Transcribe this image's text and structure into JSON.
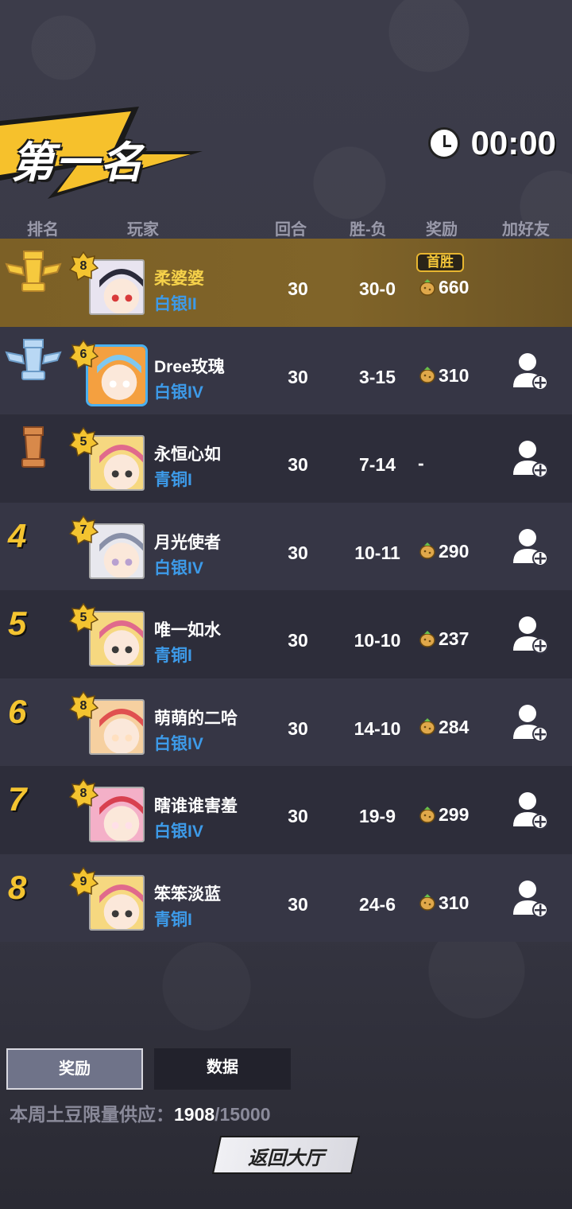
{
  "header": {
    "title": "第一名",
    "timer": "00:00"
  },
  "columns": {
    "rank": "排名",
    "player": "玩家",
    "rounds": "回合",
    "winloss": "胜-负",
    "reward": "奖励",
    "add_friend": "加好友"
  },
  "rows": [
    {
      "rank": "1",
      "rank_style": "gold-trophy",
      "level": "8",
      "name": "柔婆婆",
      "tier": "白银II",
      "rounds": "30",
      "winloss": "30-0",
      "reward": "660",
      "badge": "首胜",
      "add_friend": false
    },
    {
      "rank": "2",
      "rank_style": "silver-trophy",
      "level": "6",
      "name": "Dree玫瑰",
      "tier": "白银IV",
      "rounds": "30",
      "winloss": "3-15",
      "reward": "310",
      "add_friend": true
    },
    {
      "rank": "3",
      "rank_style": "bronze-trophy",
      "level": "5",
      "name": "永恒心如",
      "tier": "青铜I",
      "rounds": "30",
      "winloss": "7-14",
      "reward": "-",
      "add_friend": true
    },
    {
      "rank": "4",
      "rank_style": "number",
      "level": "7",
      "name": "月光使者",
      "tier": "白银IV",
      "rounds": "30",
      "winloss": "10-11",
      "reward": "290",
      "add_friend": true
    },
    {
      "rank": "5",
      "rank_style": "number",
      "level": "5",
      "name": "唯一如水",
      "tier": "青铜I",
      "rounds": "30",
      "winloss": "10-10",
      "reward": "237",
      "add_friend": true
    },
    {
      "rank": "6",
      "rank_style": "number",
      "level": "8",
      "name": "萌萌的二哈",
      "tier": "白银IV",
      "rounds": "30",
      "winloss": "14-10",
      "reward": "284",
      "add_friend": true
    },
    {
      "rank": "7",
      "rank_style": "number",
      "level": "8",
      "name": "瞎谁谁害羞",
      "tier": "白银IV",
      "rounds": "30",
      "winloss": "19-9",
      "reward": "299",
      "add_friend": true
    },
    {
      "rank": "8",
      "rank_style": "number",
      "level": "9",
      "name": "笨笨淡蓝",
      "tier": "青铜I",
      "rounds": "30",
      "winloss": "24-6",
      "reward": "310",
      "add_friend": true
    }
  ],
  "tabs": {
    "rewards": "奖励",
    "data": "数据"
  },
  "supply": {
    "label": "本周土豆限量供应：",
    "current": "1908",
    "max": "/15000"
  },
  "back_button": "返回大厅",
  "colors": {
    "gold": "#f4c430",
    "tier_blue": "#3d9ae8",
    "first_row": "#7c6026"
  }
}
